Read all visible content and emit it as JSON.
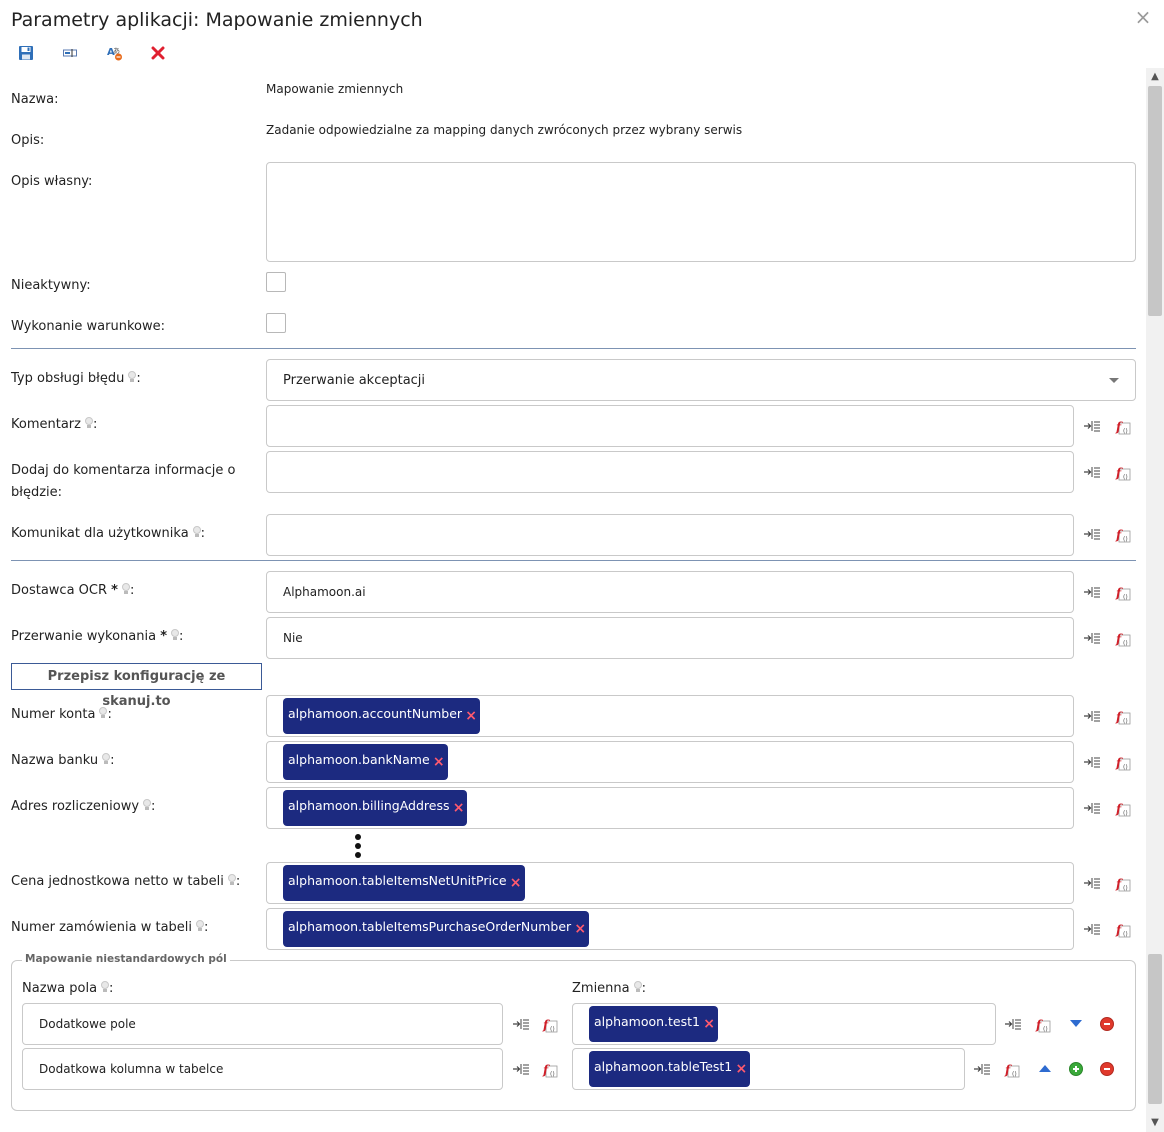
{
  "dialog": {
    "title": "Parametry aplikacji: Mapowanie zmiennych",
    "close_glyph": "×"
  },
  "toolbar": {
    "icons": [
      "save-icon",
      "rename-icon",
      "translate-icon",
      "delete-icon"
    ]
  },
  "general": {
    "name_label": "Nazwa:",
    "name_value": "Mapowanie zmiennych",
    "desc_label": "Opis:",
    "desc_value": "Zadanie odpowiedzialne za mapping danych zwróconych przez wybrany serwis",
    "own_desc_label": "Opis własny:",
    "own_desc_value": "",
    "inactive_label": "Nieaktywny:",
    "inactive_checked": false,
    "conditional_label": "Wykonanie warunkowe:",
    "conditional_checked": false
  },
  "error_handling": {
    "type_label": "Typ obsługi błędu",
    "type_value": "Przerwanie akceptacji",
    "comment_label": "Komentarz",
    "comment_value": "",
    "add_info_label": "Dodaj do komentarza informacje o błędzie:",
    "add_info_value": "",
    "user_msg_label": "Komunikat dla użytkownika",
    "user_msg_value": ""
  },
  "ocr": {
    "provider_label": "Dostawca OCR",
    "provider_value": "Alphamoon.ai",
    "stop_label": "Przerwanie wykonania",
    "stop_value": "Nie",
    "required_mark": "*",
    "rewrite_button": "Przepisz konfigurację ze skanuj.to"
  },
  "mappings": [
    {
      "label": "Numer konta",
      "tag": "alphamoon.accountNumber"
    },
    {
      "label": "Nazwa banku",
      "tag": "alphamoon.bankName"
    },
    {
      "label": "Adres rozliczeniowy",
      "tag": "alphamoon.billingAddress"
    },
    {
      "label": "Cena jednostkowa netto w tabeli",
      "tag": "alphamoon.tableItemsNetUnitPrice"
    },
    {
      "label": "Numer zamówienia w tabeli",
      "tag": "alphamoon.tableItemsPurchaseOrderNumber"
    }
  ],
  "custom": {
    "legend": "Mapowanie niestandardowych pól",
    "field_name_header": "Nazwa pola",
    "variable_header": "Zmienna",
    "rows": [
      {
        "field": "Dodatkowe pole",
        "tag": "alphamoon.test1"
      },
      {
        "field": "Dodatkowa kolumna w tabelce",
        "tag": "alphamoon.tableTest1"
      }
    ]
  },
  "colors": {
    "tag_bg": "#1c2a80",
    "tag_x": "#ff5a6e",
    "separator": "#7d93b3",
    "accent_blue": "#2e6bd0"
  },
  "colon": ":"
}
